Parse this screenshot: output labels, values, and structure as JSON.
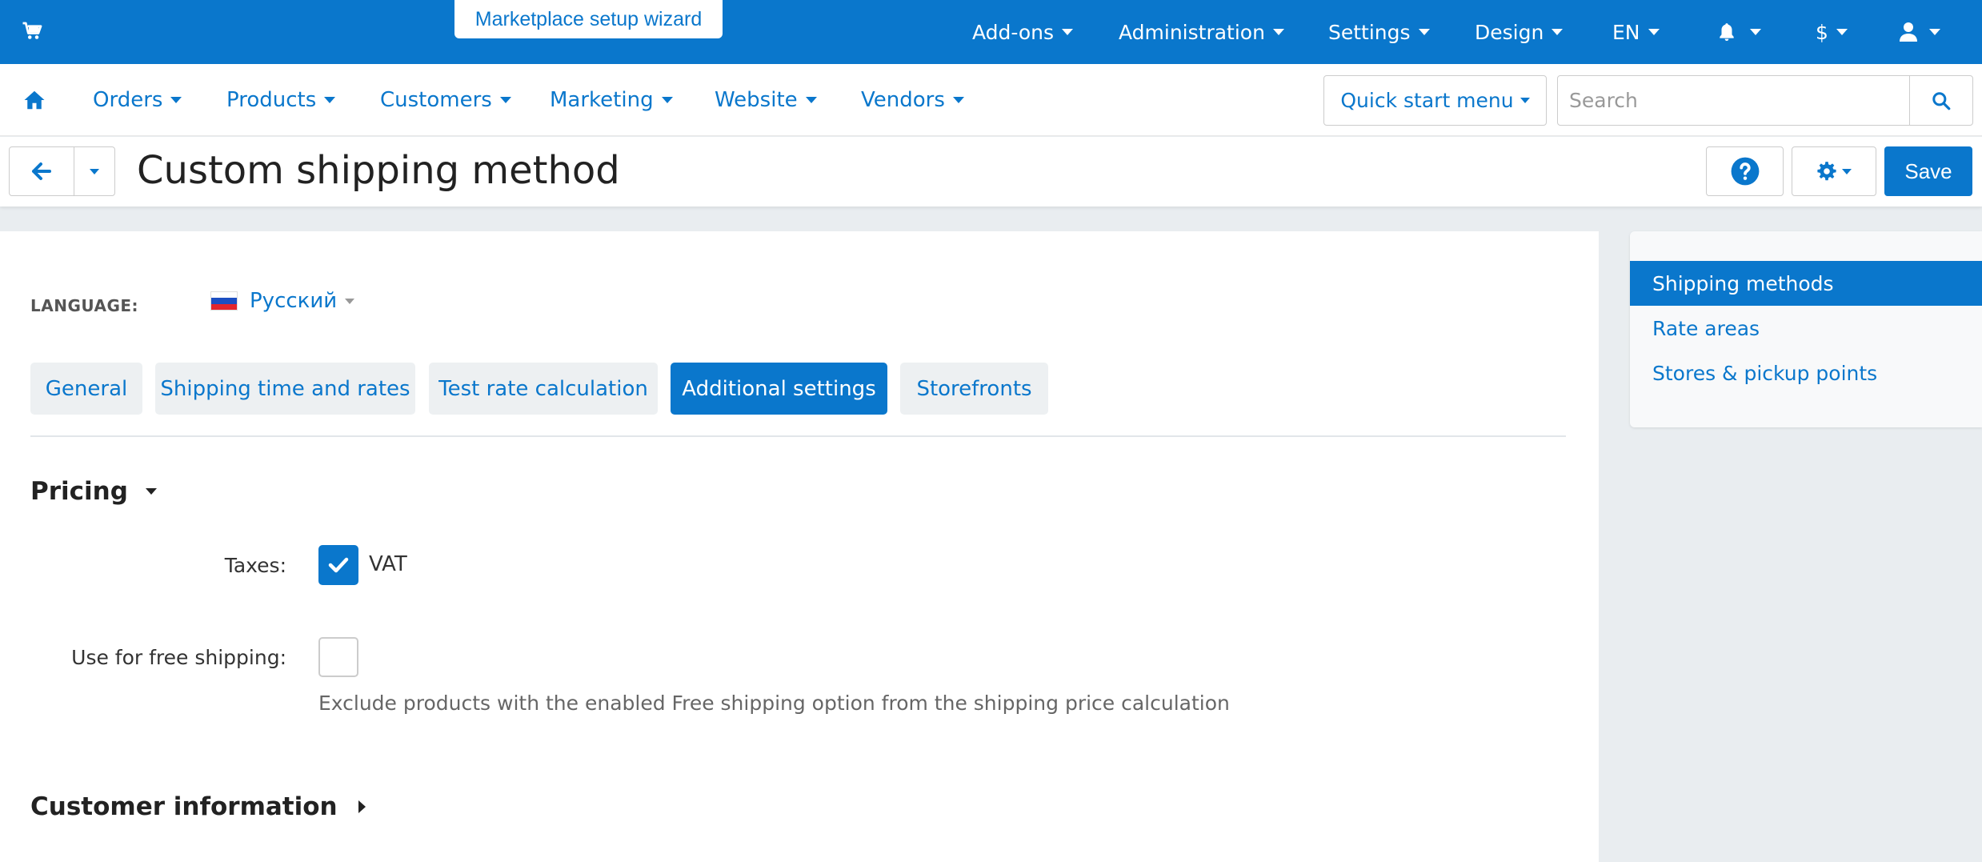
{
  "topbar": {
    "wizard_label": "Marketplace setup wizard",
    "menus": [
      "Add-ons",
      "Administration",
      "Settings",
      "Design",
      "EN"
    ],
    "currency": "$"
  },
  "nav": {
    "items": [
      "Orders",
      "Products",
      "Customers",
      "Marketing",
      "Website",
      "Vendors"
    ],
    "quick_start": "Quick start menu",
    "search_placeholder": "Search"
  },
  "page": {
    "title": "Custom shipping method",
    "save_label": "Save"
  },
  "language": {
    "label": "LANGUAGE:",
    "selected": "Русский"
  },
  "tabs": [
    {
      "label": "General",
      "active": false
    },
    {
      "label": "Shipping time and rates",
      "active": false
    },
    {
      "label": "Test rate calculation",
      "active": false
    },
    {
      "label": "Additional settings",
      "active": true
    },
    {
      "label": "Storefronts",
      "active": false
    }
  ],
  "pricing": {
    "title": "Pricing",
    "taxes_label": "Taxes:",
    "vat_label": "VAT",
    "vat_checked": true,
    "free_shipping_label": "Use for free shipping:",
    "free_shipping_checked": false,
    "free_shipping_hint": "Exclude products with the enabled Free shipping option from the shipping price calculation"
  },
  "customer_info": {
    "title": "Customer information"
  },
  "sidebar": {
    "items": [
      {
        "label": "Shipping methods",
        "active": true
      },
      {
        "label": "Rate areas",
        "active": false
      },
      {
        "label": "Stores & pickup points",
        "active": false
      }
    ]
  },
  "colors": {
    "primary": "#0a77cc",
    "background": "#e9edf0"
  }
}
